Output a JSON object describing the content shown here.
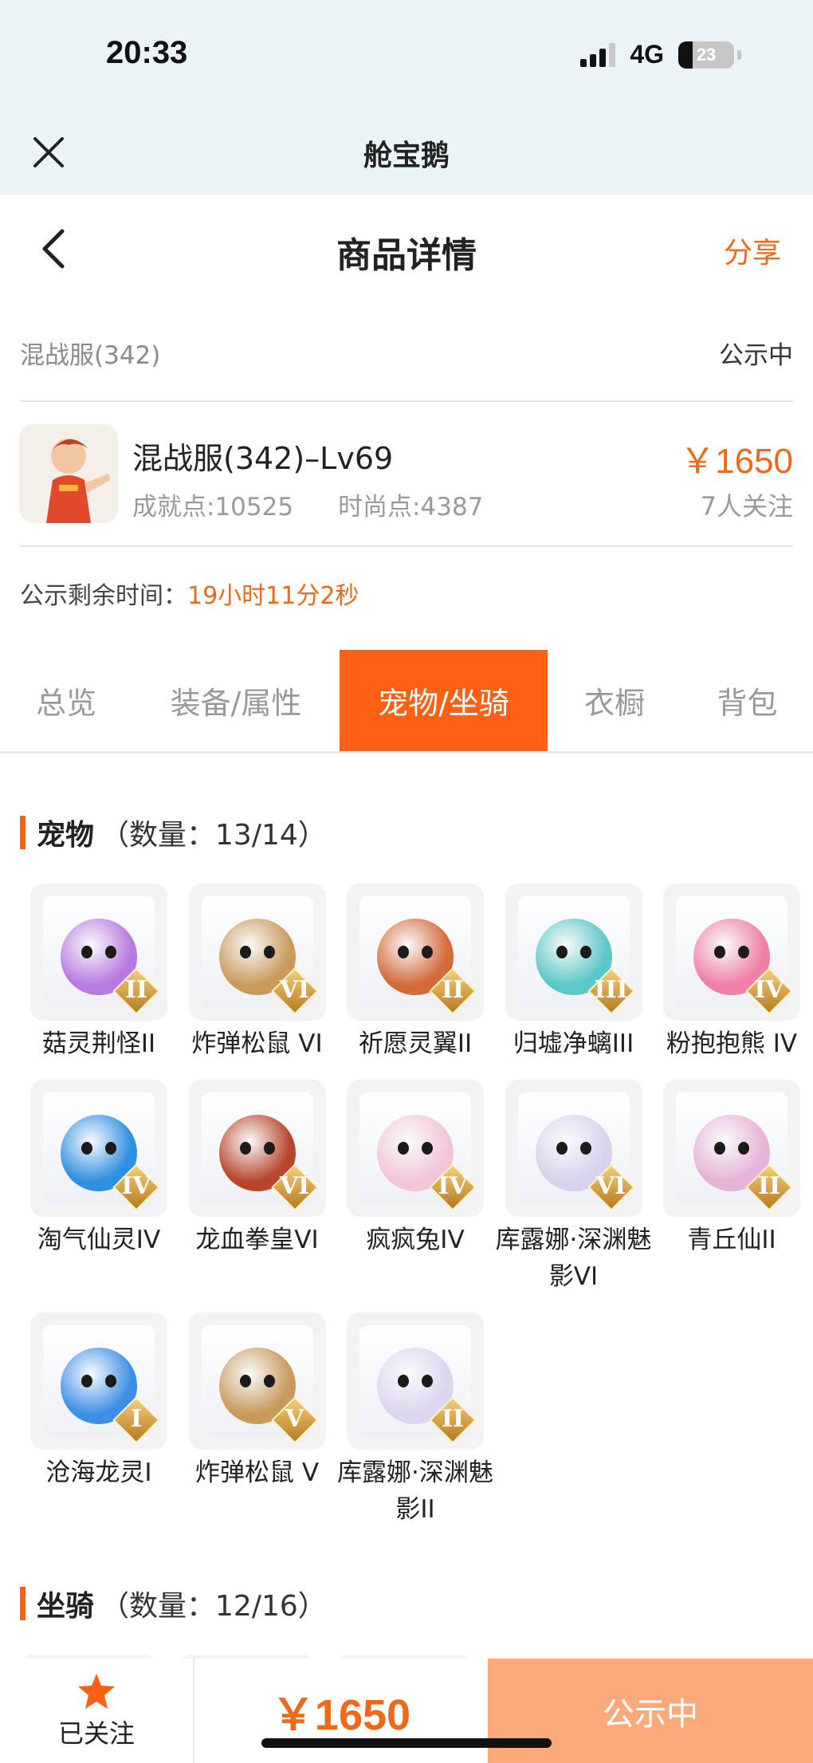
{
  "status_bar": {
    "time": "20:33",
    "network": "4G",
    "battery": "23"
  },
  "mini_program": {
    "title": "舱宝鹅"
  },
  "header": {
    "title": "商品详情",
    "share": "分享"
  },
  "listing": {
    "server": "混战服(342)",
    "status": "公示中",
    "name": "混战服(342)–Lv69",
    "achievement": "成就点:10525",
    "fashion": "时尚点:4387",
    "price": "￥1650",
    "followers": "7人关注",
    "remain_label": "公示剩余时间：",
    "remain_value": "19小时11分2秒"
  },
  "tabs": [
    "总览",
    "装备/属性",
    "宠物/坐骑",
    "衣橱",
    "背包"
  ],
  "active_tab": "宠物/坐骑",
  "pets": {
    "title": "宠物",
    "count": "（数量：13/14）",
    "items": [
      {
        "name": "菇灵荆怪II",
        "grade": "II",
        "color": "#b77ae0"
      },
      {
        "name": "炸弹松鼠 VI",
        "grade": "VI",
        "color": "#c99a5c"
      },
      {
        "name": "祈愿灵翼II",
        "grade": "II",
        "color": "#d46a3a"
      },
      {
        "name": "归墟净螭III",
        "grade": "III",
        "color": "#5cc7c7"
      },
      {
        "name": "粉抱抱熊 IV",
        "grade": "IV",
        "color": "#f07fa8"
      },
      {
        "name": "淘气仙灵IV",
        "grade": "IV",
        "color": "#2f8fe0"
      },
      {
        "name": "龙血拳皇VI",
        "grade": "VI",
        "color": "#b8462c"
      },
      {
        "name": "疯疯兔IV",
        "grade": "IV",
        "color": "#f2c6d8"
      },
      {
        "name": "库露娜·深渊魅影VI",
        "grade": "VI",
        "color": "#d9d2ec"
      },
      {
        "name": "青丘仙II",
        "grade": "II",
        "color": "#e7b3d6"
      },
      {
        "name": "沧海龙灵I",
        "grade": "I",
        "color": "#3d8fe6"
      },
      {
        "name": "炸弹松鼠 V",
        "grade": "V",
        "color": "#c99a5c"
      },
      {
        "name": "库露娜·深渊魅影II",
        "grade": "II",
        "color": "#dcd6ee"
      }
    ]
  },
  "mounts": {
    "title": "坐骑",
    "count": "（数量：12/16）"
  },
  "bottom": {
    "follow_label": "已关注",
    "price": "￥1650",
    "action": "公示中"
  },
  "colors": {
    "accent": "#ff6014",
    "price": "#ee6a1a",
    "action_bg": "#fca97c"
  }
}
